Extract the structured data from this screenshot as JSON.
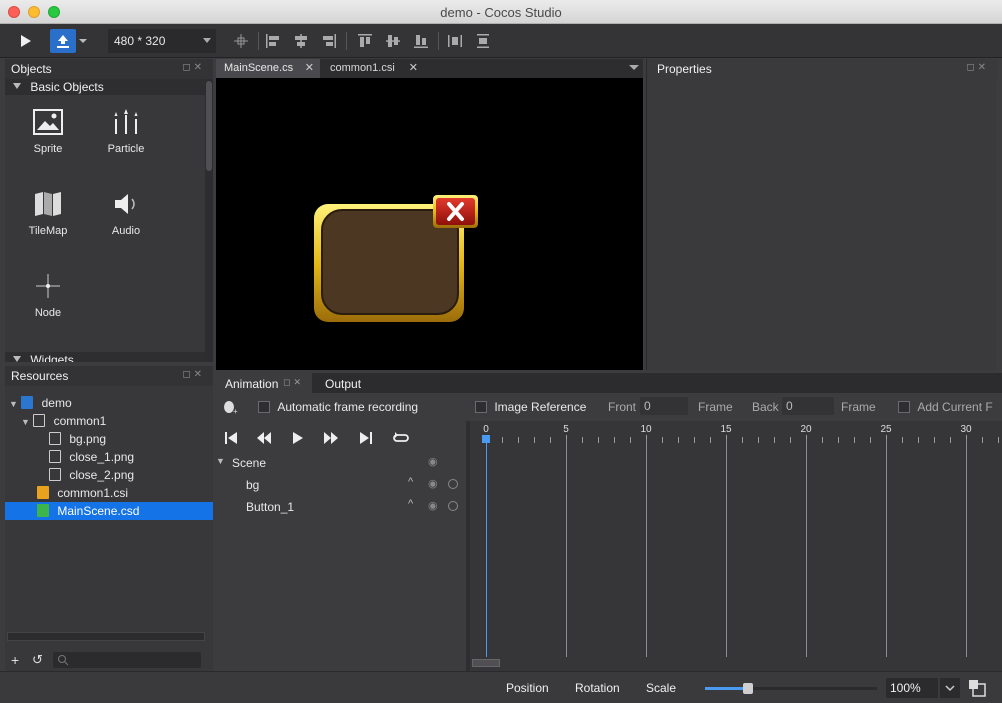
{
  "window": {
    "title": "demo - Cocos Studio"
  },
  "toolbar": {
    "resolution": "480 * 320"
  },
  "objects_panel": {
    "title": "Objects",
    "section": "Basic Objects",
    "next_section": "Widgets",
    "items": [
      {
        "label": "Sprite",
        "icon": "image-icon"
      },
      {
        "label": "Particle",
        "icon": "particle-icon"
      },
      {
        "label": "TileMap",
        "icon": "tilemap-icon"
      },
      {
        "label": "Audio",
        "icon": "speaker-icon"
      },
      {
        "label": "Node",
        "icon": "node-icon"
      }
    ]
  },
  "resources_panel": {
    "title": "Resources",
    "tree": [
      {
        "label": "demo",
        "type": "project",
        "depth": 0
      },
      {
        "label": "common1",
        "type": "folder",
        "depth": 1
      },
      {
        "label": "bg.png",
        "type": "image",
        "depth": 2
      },
      {
        "label": "close_1.png",
        "type": "image",
        "depth": 2
      },
      {
        "label": "close_2.png",
        "type": "image",
        "depth": 2
      },
      {
        "label": "common1.csi",
        "type": "csi",
        "depth": 1
      },
      {
        "label": "MainScene.csd",
        "type": "csd",
        "depth": 1,
        "selected": true
      }
    ]
  },
  "document_tabs": [
    {
      "label": "MainScene.cs",
      "active": true
    },
    {
      "label": "common1.csi",
      "active": false
    }
  ],
  "properties_panel": {
    "title": "Properties"
  },
  "animation": {
    "tabs": [
      "Animation",
      "Output"
    ],
    "auto_frame_label": "Automatic frame recording",
    "image_reference_label": "Image Reference",
    "front_label": "Front",
    "front_value": "0",
    "frame_label": "Frame",
    "back_label": "Back",
    "back_value": "0",
    "frame_label_2": "Frame",
    "add_current_label": "Add Current F",
    "ruler": [
      "0",
      "5",
      "10",
      "15",
      "20",
      "25",
      "30"
    ],
    "tree": [
      {
        "label": "Scene"
      },
      {
        "label": "bg"
      },
      {
        "label": "Button_1"
      }
    ]
  },
  "statusbar": {
    "position_label": "Position",
    "rotation_label": "Rotation",
    "scale_label": "Scale",
    "zoom": "100%",
    "zoom_level": 0.25
  }
}
